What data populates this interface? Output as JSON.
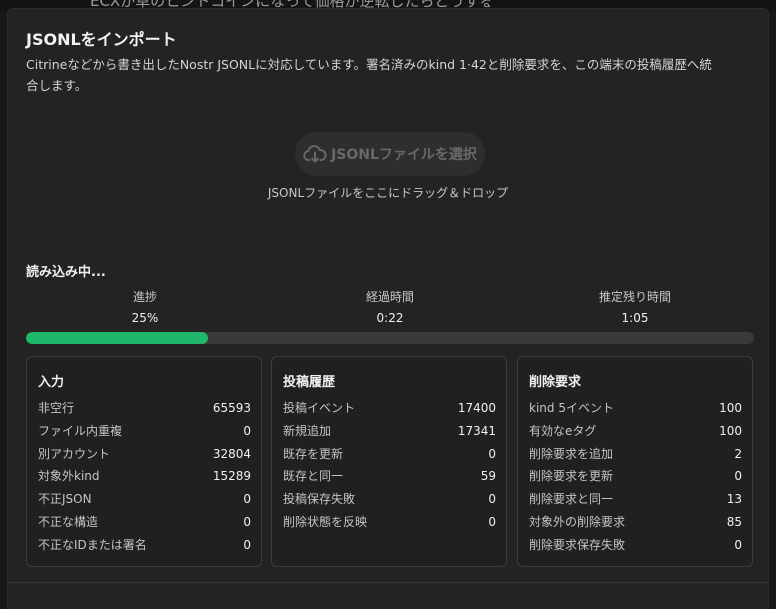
{
  "background": {
    "text": "ECXが草のヒントコインになって価格が逆転したらどうする？！"
  },
  "dialog": {
    "title": "JSONLをインポート",
    "description": "Citrineなどから書き出したNostr JSONLに対応しています。署名済みのkind 1·42と削除要求を、この端末の投稿履歴へ統合します。",
    "select_button": "JSONLファイルを選択",
    "drop_hint": "JSONLファイルをここにドラッグ＆ドロップ"
  },
  "status": {
    "loading": "読み込み中...",
    "progress_label": "進捗",
    "progress_value": "25%",
    "progress_fraction": 0.25,
    "elapsed_label": "経過時間",
    "elapsed_value": "0:22",
    "remaining_label": "推定残り時間",
    "remaining_value": "1:05"
  },
  "panels": [
    {
      "title": "入力",
      "rows": [
        {
          "label": "非空行",
          "value": "65593"
        },
        {
          "label": "ファイル内重複",
          "value": "0"
        },
        {
          "label": "別アカウント",
          "value": "32804"
        },
        {
          "label": "対象外kind",
          "value": "15289"
        },
        {
          "label": "不正JSON",
          "value": "0"
        },
        {
          "label": "不正な構造",
          "value": "0"
        },
        {
          "label": "不正なIDまたは署名",
          "value": "0"
        }
      ]
    },
    {
      "title": "投稿履歴",
      "rows": [
        {
          "label": "投稿イベント",
          "value": "17400"
        },
        {
          "label": "新規追加",
          "value": "17341"
        },
        {
          "label": "既存を更新",
          "value": "0"
        },
        {
          "label": "既存と同一",
          "value": "59"
        },
        {
          "label": "投稿保存失敗",
          "value": "0"
        },
        {
          "label": "削除状態を反映",
          "value": "0"
        }
      ]
    },
    {
      "title": "削除要求",
      "rows": [
        {
          "label": "kind 5イベント",
          "value": "100"
        },
        {
          "label": "有効なeタグ",
          "value": "100"
        },
        {
          "label": "削除要求を追加",
          "value": "2"
        },
        {
          "label": "削除要求を更新",
          "value": "0"
        },
        {
          "label": "削除要求と同一",
          "value": "13"
        },
        {
          "label": "対象外の削除要求",
          "value": "85"
        },
        {
          "label": "削除要求保存失敗",
          "value": "0"
        }
      ]
    }
  ],
  "colors": {
    "accent": "#1fb86a",
    "surface": "#232323"
  },
  "icons": {
    "select_button": "cloud-download-icon"
  }
}
